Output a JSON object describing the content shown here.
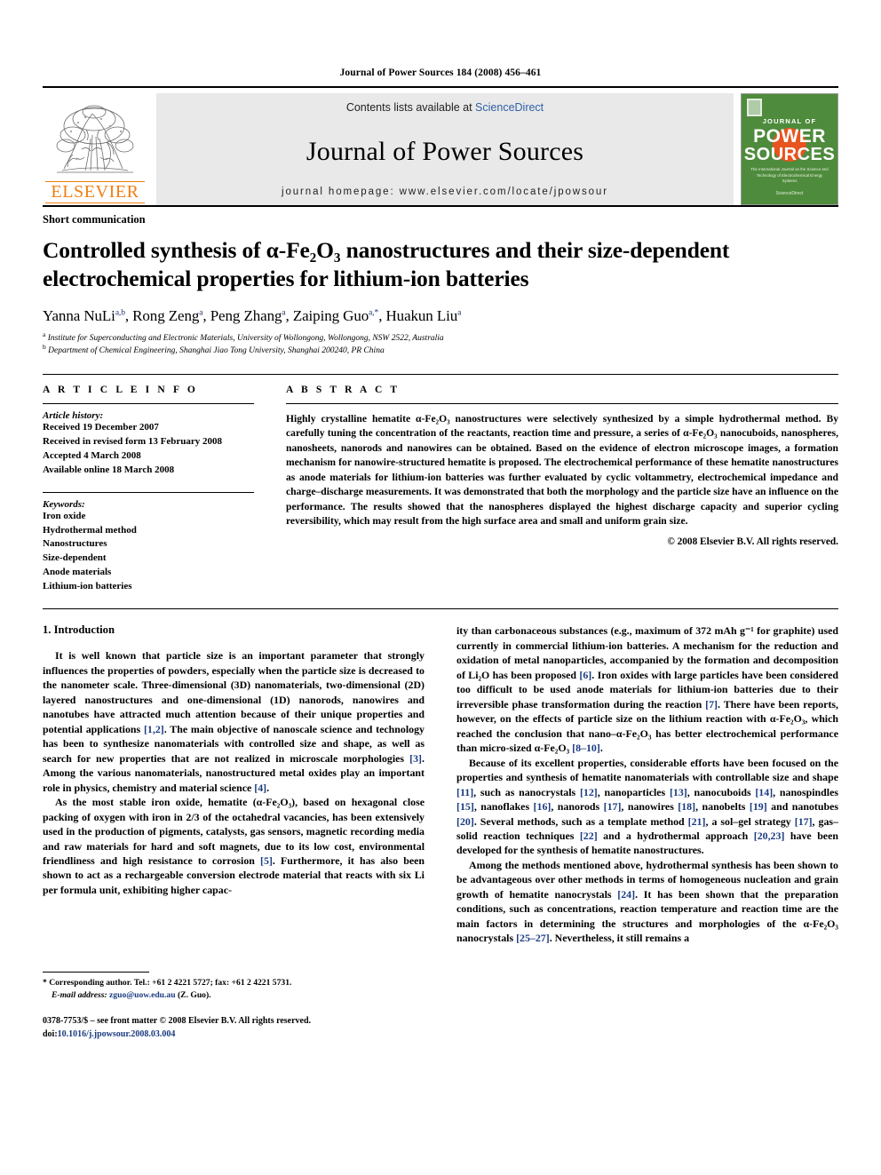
{
  "running_head": "Journal of Power Sources 184 (2008) 456–461",
  "masthead": {
    "publisher_name": "ELSEVIER",
    "contents_line_prefix": "Contents lists available at ",
    "sciencedirect": "ScienceDirect",
    "journal_title": "Journal of Power Sources",
    "homepage_line": "journal homepage: www.elsevier.com/locate/jpowsour",
    "cover": {
      "journal_of": "JOURNAL OF",
      "power": "POWER",
      "sources": "SOURCES",
      "strapline": "The International Journal on the Science and Technology of Electrochemical Energy Systems",
      "footer": "ScienceDirect"
    },
    "colors": {
      "elsevier_orange": "#F07F13",
      "sciencedirect_blue": "#2E5FA8",
      "cover_green": "#4E8B3C",
      "cover_sun_orange": "#E8541F",
      "banner_gray": "#e9e9e9"
    }
  },
  "article": {
    "doctype": "Short communication",
    "title": "Controlled synthesis of α-Fe₂O₃ nanostructures and their size-dependent electrochemical properties for lithium-ion batteries",
    "authors_html": "Yanna NuLi<sup>a,b</sup>, Rong Zeng<sup>a</sup>, Peng Zhang<sup>a</sup>, Zaiping Guo<sup>a,</sup><sup>*</sup>, Huakun Liu<sup>a</sup>",
    "affiliations": [
      {
        "marker": "a",
        "text": "Institute for Superconducting and Electronic Materials, University of Wollongong, Wollongong, NSW 2522, Australia"
      },
      {
        "marker": "b",
        "text": "Department of Chemical Engineering, Shanghai Jiao Tong University, Shanghai 200240, PR China"
      }
    ]
  },
  "article_info": {
    "heading": "A R T I C L E    I N F O",
    "history_title": "Article history:",
    "history": [
      "Received 19 December 2007",
      "Received in revised form 13 February 2008",
      "Accepted 4 March 2008",
      "Available online 18 March 2008"
    ],
    "keywords_title": "Keywords:",
    "keywords": [
      "Iron oxide",
      "Hydrothermal method",
      "Nanostructures",
      "Size-dependent",
      "Anode materials",
      "Lithium-ion batteries"
    ]
  },
  "abstract": {
    "heading": "A B S T R A C T",
    "text": "Highly crystalline hematite α-Fe₂O₃ nanostructures were selectively synthesized by a simple hydrothermal method. By carefully tuning the concentration of the reactants, reaction time and pressure, a series of α-Fe₂O₃ nanocuboids, nanospheres, nanosheets, nanorods and nanowires can be obtained. Based on the evidence of electron microscope images, a formation mechanism for nanowire-structured hematite is proposed. The electrochemical performance of these hematite nanostructures as anode materials for lithium-ion batteries was further evaluated by cyclic voltammetry, electrochemical impedance and charge–discharge measurements. It was demonstrated that both the morphology and the particle size have an influence on the performance. The results showed that the nanospheres displayed the highest discharge capacity and superior cycling reversibility, which may result from the high surface area and small and uniform grain size.",
    "copyright": "© 2008 Elsevier B.V. All rights reserved."
  },
  "body": {
    "section_heading": "1.  Introduction",
    "left_paragraphs": [
      "It is well known that particle size is an important parameter that strongly influences the properties of powders, especially when the particle size is decreased to the nanometer scale. Three-dimensional (3D) nanomaterials, two-dimensional (2D) layered nanostructures and one-dimensional (1D) nanorods, nanowires and nanotubes have attracted much attention because of their unique properties and potential applications [1,2]. The main objective of nanoscale science and technology has been to synthesize nanomaterials with controlled size and shape, as well as search for new properties that are not realized in microscale morphologies [3]. Among the various nanomaterials, nanostructured metal oxides play an important role in physics, chemistry and material science [4].",
      "As the most stable iron oxide, hematite (α-Fe₂O₃), based on hexagonal close packing of oxygen with iron in 2/3 of the octahedral vacancies, has been extensively used in the production of pigments, catalysts, gas sensors, magnetic recording media and raw materials for hard and soft magnets, due to its low cost, environmental friendliness and high resistance to corrosion [5]. Furthermore, it has also been shown to act as a rechargeable conversion electrode material that reacts with six Li per formula unit, exhibiting higher capac-"
    ],
    "right_paragraphs": [
      "ity than carbonaceous substances (e.g., maximum of 372 mAh g⁻¹ for graphite) used currently in commercial lithium-ion batteries. A mechanism for the reduction and oxidation of metal nanoparticles, accompanied by the formation and decomposition of Li₂O has been proposed [6]. Iron oxides with large particles have been considered too difficult to be used anode materials for lithium-ion batteries due to their irreversible phase transformation during the reaction [7]. There have been reports, however, on the effects of particle size on the lithium reaction with α-Fe₂O₃, which reached the conclusion that nano–α-Fe₂O₃ has better electrochemical performance than micro-sized α-Fe₂O₃ [8–10].",
      "Because of its excellent properties, considerable efforts have been focused on the properties and synthesis of hematite nanomaterials with controllable size and shape [11], such as nanocrystals [12], nanoparticles [13], nanocuboids [14], nanospindles [15], nanoflakes [16], nanorods [17], nanowires [18], nanobelts [19] and nanotubes [20]. Several methods, such as a template method [21], a sol–gel strategy [17], gas–solid reaction techniques [22] and a hydrothermal approach [20,23] have been developed for the synthesis of hematite nanostructures.",
      "Among the methods mentioned above, hydrothermal synthesis has been shown to be advantageous over other methods in terms of homogeneous nucleation and grain growth of hematite nanocrystals [24]. It has been shown that the preparation conditions, such as concentrations, reaction temperature and reaction time are the main factors in determining the structures and morphologies of the α-Fe₂O₃ nanocrystals [25–27]. Nevertheless, it still remains a"
    ]
  },
  "footnotes": {
    "corresponding_marker": "*",
    "corresponding_text": "Corresponding author. Tel.: +61 2 4221 5727; fax: +61 2 4221 5731.",
    "email_label": "E-mail address:",
    "email": "zguo@uow.edu.au",
    "email_owner": "(Z. Guo).",
    "issn_line": "0378-7753/$ – see front matter © 2008 Elsevier B.V. All rights reserved.",
    "doi_label": "doi:",
    "doi": "10.1016/j.jpowsour.2008.03.004"
  }
}
